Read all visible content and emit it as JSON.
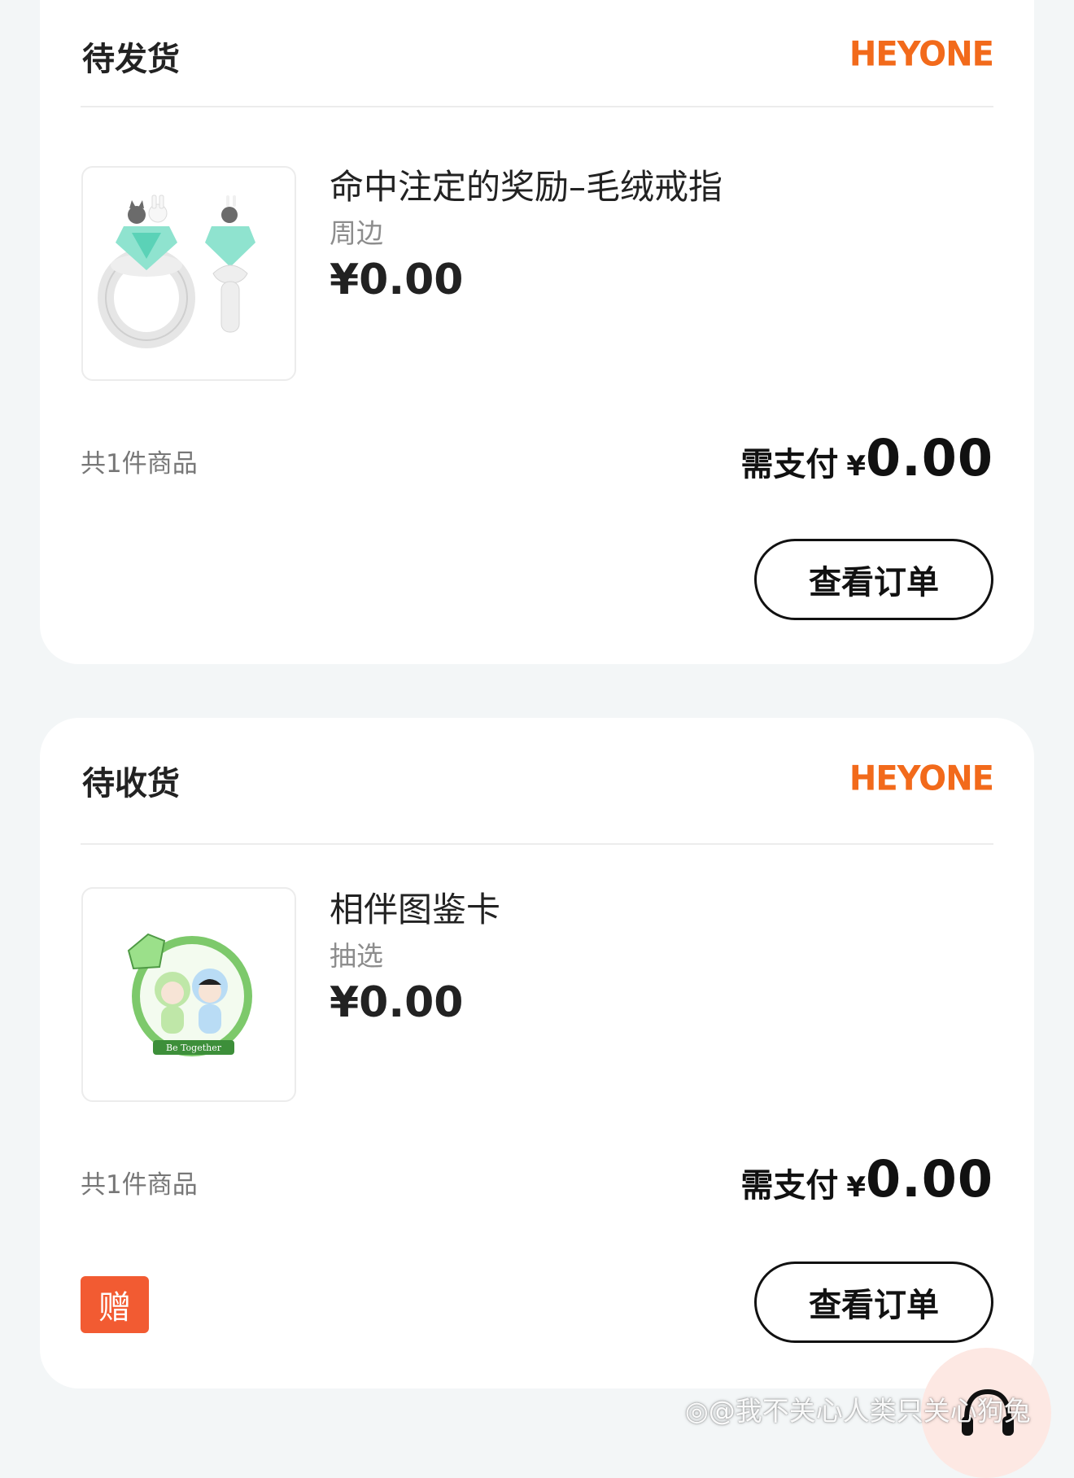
{
  "orders": [
    {
      "status": "待发货",
      "brand": "HEYONE",
      "product_title": "命中注定的奖励–毛绒戒指",
      "category": "周边",
      "price": "¥0.00",
      "item_count": "共1件商品",
      "pay_label": "需支付",
      "pay_currency": "¥",
      "pay_value": "0.00",
      "action_label": "查看订单"
    },
    {
      "status": "待收货",
      "brand": "HEYONE",
      "product_title": "相伴图鉴卡",
      "category": "抽选",
      "price": "¥0.00",
      "item_count": "共1件商品",
      "pay_label": "需支付",
      "pay_currency": "¥",
      "pay_value": "0.00",
      "gift_badge": "赠",
      "action_label": "查看订单",
      "card_text": "Be Together"
    }
  ],
  "watermark": "@我不关心人类只关心狗兔",
  "icons": {
    "product_1": "plush-ring-image",
    "product_2": "sticker-card-image",
    "floating": "customer-service-icon",
    "watermark": "weibo-icon"
  },
  "colors": {
    "brand": "#f26a1b",
    "gift_badge": "#f25b32",
    "background": "#f3f6f7"
  }
}
